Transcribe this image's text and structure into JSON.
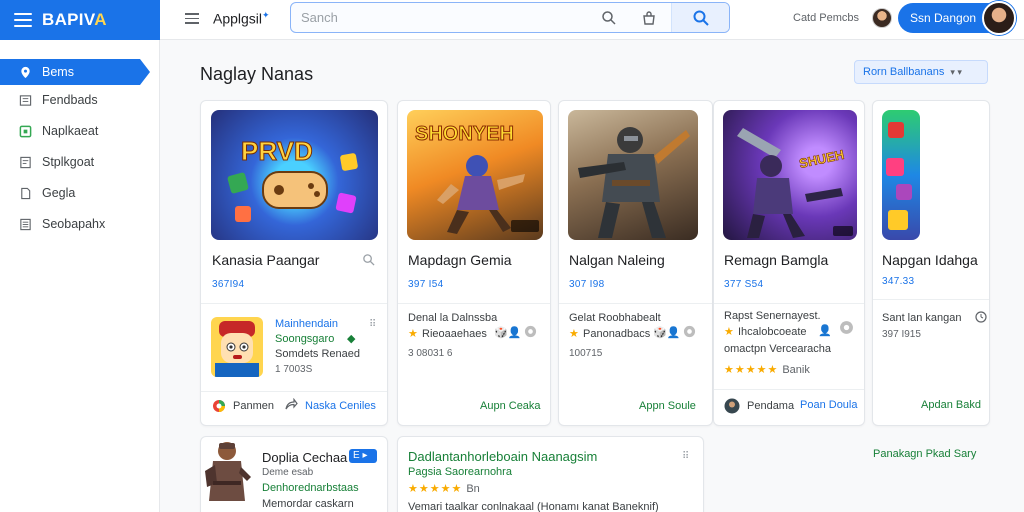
{
  "brand": {
    "name_part1": "BAPIV",
    "name_part2": "A"
  },
  "topbar": {
    "title": "Applgsil",
    "search_placeholder": "Sanch",
    "cart_label": "Catd Pemcbs",
    "signin_label": "Ssn Dangon"
  },
  "sidebar": {
    "items": [
      {
        "label": "Bems",
        "icon": "location-pin-icon",
        "active": true
      },
      {
        "label": "Fendbads",
        "icon": "news-icon",
        "active": false
      },
      {
        "label": "Naplkaeat",
        "icon": "apps-icon",
        "active": false
      },
      {
        "label": "Stplkgoat",
        "icon": "document-icon",
        "active": false
      },
      {
        "label": "Gegla",
        "icon": "file-icon",
        "active": false
      },
      {
        "label": "Seobapahx",
        "icon": "list-icon",
        "active": false
      }
    ]
  },
  "main": {
    "section_title": "Naglay Nanas",
    "sort_label": "Rorn Ballbanans",
    "cards": [
      {
        "title": "Kanasia Paangar",
        "count": "367I94",
        "sub_title": "Mainhendain",
        "sub_line1": "Soongsgaro",
        "sub_line2": "Somdets Renaed",
        "sub_meta": "1 7003S",
        "footer_left": "Panmen",
        "footer_link": "Naska Ceniles"
      },
      {
        "title": "Mapdagn Gemia",
        "count": "397 I54",
        "sub_title": "Denal la Dalnssba",
        "sub_line1": "Rieoaaehaes",
        "sub_meta": "3 08031 6",
        "footer_link": "Aupn Ceaka"
      },
      {
        "title": "Nalgan Naleing",
        "count": "307 I98",
        "sub_title": "Gelat Roobhabealt",
        "sub_line1": "Panonadbacs",
        "sub_meta": "100715",
        "footer_link": "Appn Soule"
      },
      {
        "title": "Remagn Bamgla",
        "count": "377 S54",
        "sub_title": "Rapst Senernayest.",
        "sub_line1": "Ihcalobcoeate",
        "sub_line2": "omactpn Vercearacha",
        "stars": "★★★★★",
        "review_count": "Banik",
        "footer_left": "Pendama",
        "footer_link": "Poan Doula"
      },
      {
        "title": "Napgan Idahga",
        "count": "347.33",
        "sub_title": "Sant lan kangan",
        "sub_meta": "397 I915",
        "footer_link": "Apdan Bakd"
      }
    ],
    "row2": [
      {
        "title": "Doplia Cechaa",
        "badge": "E",
        "line1": "Deme esab",
        "line2": "Denhorednarbstaas",
        "line3": "Memordar caskarn"
      },
      {
        "title": "Dadlantanhorleboain Naanagsim",
        "line1": "Pagsia Saorearnohra",
        "stars": "★★★★★",
        "review_count": "Bn",
        "line3": "Vemari taalkar conlnakaal (Honamı kanat Baneknif)"
      }
    ],
    "row2_link": "Panakagn Pkad Sary"
  },
  "colors": {
    "accent": "#1a73e8",
    "link_green": "#188038",
    "star": "#f9ab00"
  }
}
